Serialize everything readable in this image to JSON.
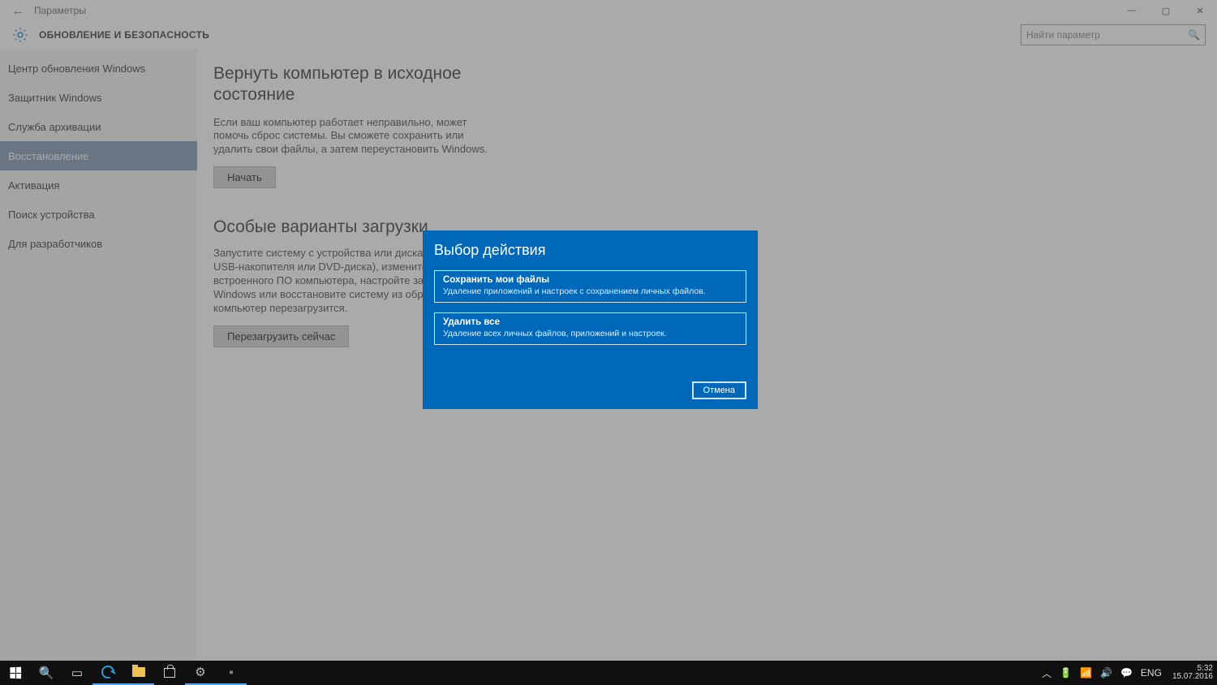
{
  "titlebar": {
    "title": "Параметры"
  },
  "header": {
    "section_title": "ОБНОВЛЕНИЕ И БЕЗОПАСНОСТЬ",
    "search_placeholder": "Найти параметр"
  },
  "sidebar": {
    "items": [
      "Центр обновления Windows",
      "Защитник Windows",
      "Служба архивации",
      "Восстановление",
      "Активация",
      "Поиск устройства",
      "Для разработчиков"
    ],
    "selected_index": 3
  },
  "content": {
    "reset_title": "Вернуть компьютер в исходное состояние",
    "reset_desc": "Если ваш компьютер работает неправильно, может помочь сброс системы. Вы сможете сохранить или удалить свои файлы, а затем переустановить Windows.",
    "reset_button": "Начать",
    "advanced_title": "Особые варианты загрузки",
    "advanced_desc": "Запустите систему с устройства или диска (например, USB-накопителя или DVD-диска), измените параметры встроенного ПО компьютера, настройте загрузку Windows или восстановите систему из образа. Ваш компьютер перезагрузится.",
    "restart_button": "Перезагрузить сейчас"
  },
  "dialog": {
    "title": "Выбор действия",
    "option1_title": "Сохранить мои файлы",
    "option1_desc": "Удаление приложений и настроек с сохранением личных файлов.",
    "option2_title": "Удалить все",
    "option2_desc": "Удаление всех личных файлов, приложений и настроек.",
    "cancel": "Отмена"
  },
  "taskbar": {
    "lang": "ENG",
    "time": "5:32",
    "date": "15.07.2016"
  }
}
